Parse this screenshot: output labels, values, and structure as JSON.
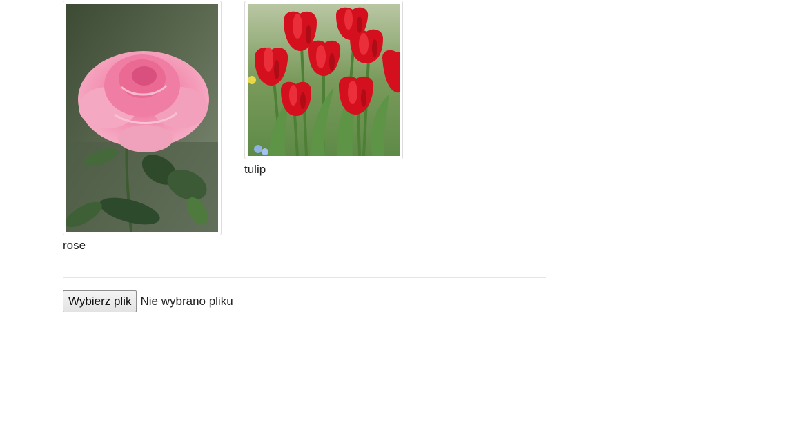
{
  "gallery": {
    "items": [
      {
        "image": "rose-photo",
        "caption": "rose"
      },
      {
        "image": "tulip-photo",
        "caption": "tulip"
      }
    ]
  },
  "upload": {
    "button_label": "Wybierz plik",
    "status_text": "Nie wybrano pliku"
  },
  "colors": {
    "thumbnail_border": "#dddddd",
    "divider": "#e5e5e5",
    "text": "#222222"
  }
}
